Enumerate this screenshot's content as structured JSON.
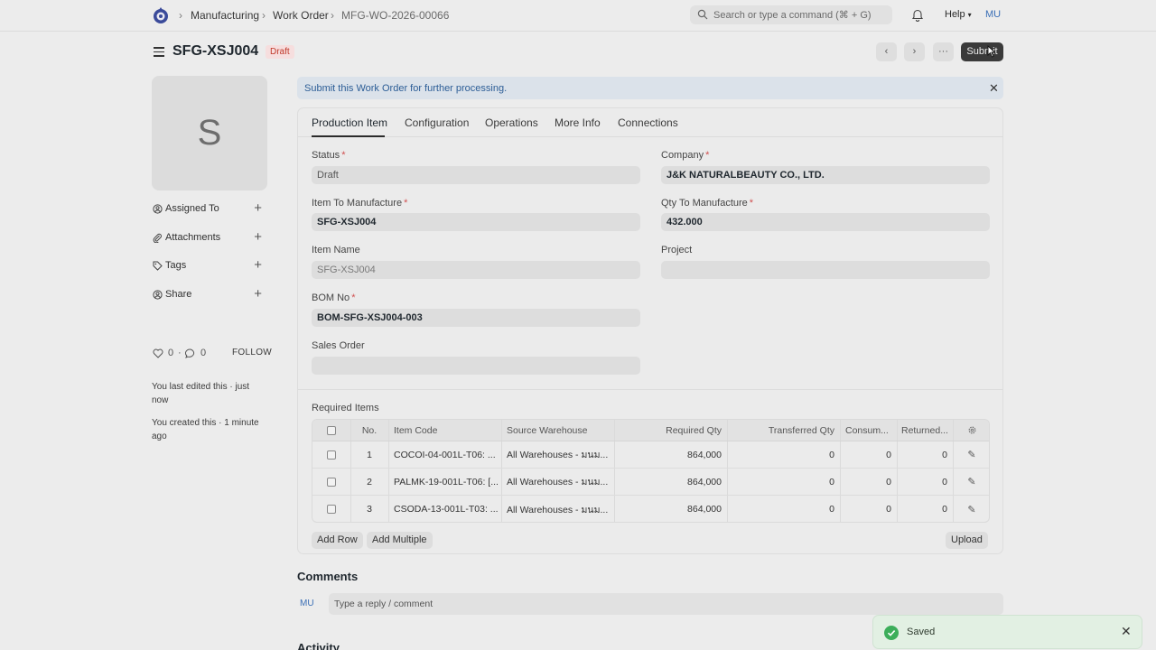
{
  "navbar": {
    "breadcrumbs": [
      "Manufacturing",
      "Work Order",
      "MFG-WO-2026-00066"
    ],
    "search_placeholder": "Search or type a command (⌘ + G)",
    "help_label": "Help",
    "user_initials": "MU"
  },
  "page": {
    "title": "SFG-XSJ004",
    "status_badge": "Draft",
    "submit_label": "Submit"
  },
  "sidebar": {
    "avatar_letter": "S",
    "items": [
      {
        "label": "Assigned To",
        "icon": "assign-icon"
      },
      {
        "label": "Attachments",
        "icon": "paperclip-icon"
      },
      {
        "label": "Tags",
        "icon": "tag-icon"
      },
      {
        "label": "Share",
        "icon": "share-icon"
      }
    ],
    "likes": "0",
    "comments": "0",
    "follow_label": "FOLLOW",
    "last_edited": "You last edited this · just now",
    "created": "You created this · 1 minute ago"
  },
  "alert": {
    "message": "Submit this Work Order for further processing."
  },
  "tabs": [
    "Production Item",
    "Configuration",
    "Operations",
    "More Info",
    "Connections"
  ],
  "form": {
    "status": {
      "label": "Status",
      "value": "Draft"
    },
    "company": {
      "label": "Company",
      "value": "J&K NATURALBEAUTY CO., LTD."
    },
    "item_to_manufacture": {
      "label": "Item To Manufacture",
      "value": "SFG-XSJ004"
    },
    "qty_to_manufacture": {
      "label": "Qty To Manufacture",
      "value": "432.000"
    },
    "item_name": {
      "label": "Item Name",
      "value": "SFG-XSJ004"
    },
    "project": {
      "label": "Project",
      "value": ""
    },
    "bom_no": {
      "label": "BOM No",
      "value": "BOM-SFG-XSJ004-003"
    },
    "sales_order": {
      "label": "Sales Order",
      "value": ""
    }
  },
  "required_items": {
    "title": "Required Items",
    "columns": [
      "No.",
      "Item Code",
      "Source Warehouse",
      "Required Qty",
      "Transferred Qty",
      "Consum...",
      "Returned..."
    ],
    "rows": [
      {
        "no": "1",
        "item_code": "COCOI-04-001L-T06: ...",
        "warehouse": "All Warehouses - มนม...",
        "required": "864,000",
        "transferred": "0",
        "consumed": "0",
        "returned": "0"
      },
      {
        "no": "2",
        "item_code": "PALMK-19-001L-T06: [...",
        "warehouse": "All Warehouses - มนม...",
        "required": "864,000",
        "transferred": "0",
        "consumed": "0",
        "returned": "0"
      },
      {
        "no": "3",
        "item_code": "CSODA-13-001L-T03: ...",
        "warehouse": "All Warehouses - มนม...",
        "required": "864,000",
        "transferred": "0",
        "consumed": "0",
        "returned": "0"
      }
    ],
    "add_row_label": "Add Row",
    "add_multiple_label": "Add Multiple",
    "upload_label": "Upload"
  },
  "comments": {
    "title": "Comments",
    "avatar": "MU",
    "placeholder": "Type a reply / comment"
  },
  "activity": {
    "title": "Activity"
  },
  "toast": {
    "message": "Saved"
  }
}
